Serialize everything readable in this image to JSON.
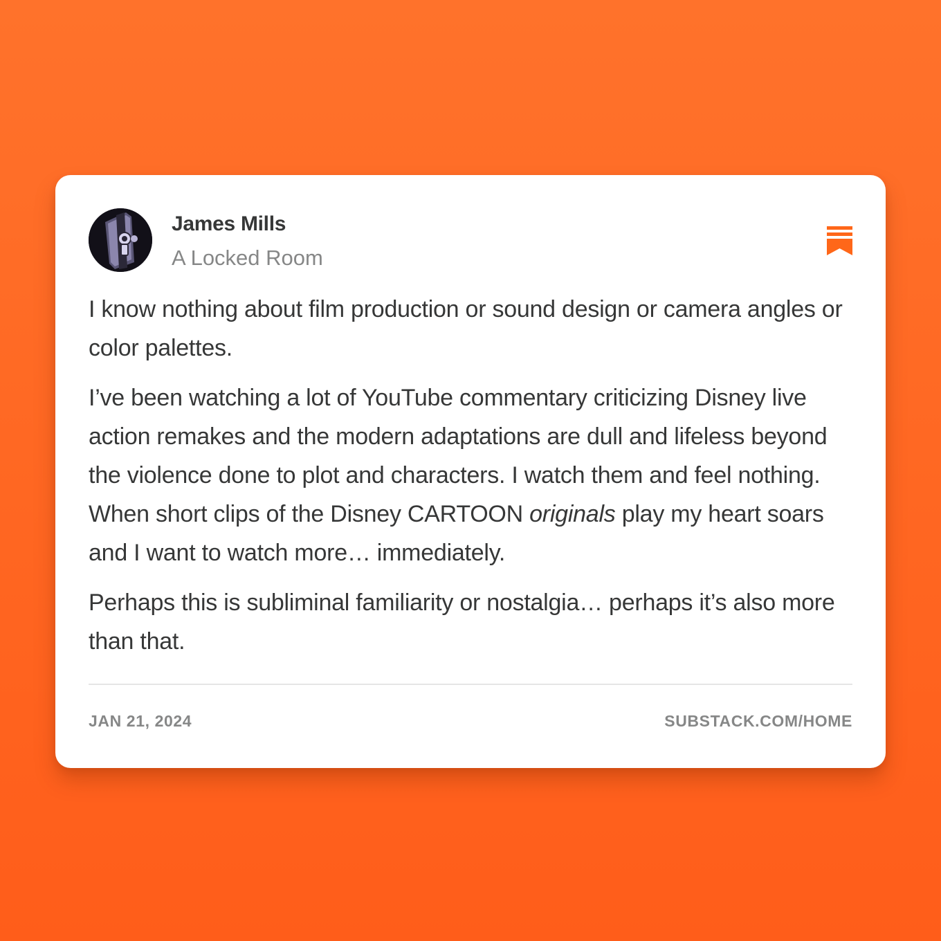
{
  "author": {
    "name": "James Mills",
    "publication": "A Locked Room",
    "avatar_icon": "locked-door-keyhole-icon"
  },
  "logo": {
    "icon": "substack-logo-icon",
    "color": "#ff6719"
  },
  "post": {
    "p1": "I know nothing about film production or sound design or camera angles or color palettes.",
    "p2_before": "I’ve been watching a lot of YouTube commentary criticizing Disney live action remakes and the modern adaptations are dull and lifeless beyond the violence done to plot and characters. I watch them and feel nothing. When short clips of the Disney CARTOON ",
    "p2_em": "originals",
    "p2_after": " play my heart soars and I want to watch more… immediately.",
    "p3": "Perhaps this is subliminal familiarity or nostalgia… perhaps it’s also more than that."
  },
  "footer": {
    "date": "JAN 21, 2024",
    "link": "SUBSTACK.COM/HOME"
  },
  "colors": {
    "background": "#ff6a24",
    "card": "#ffffff",
    "text": "#363737",
    "muted": "#868787"
  }
}
